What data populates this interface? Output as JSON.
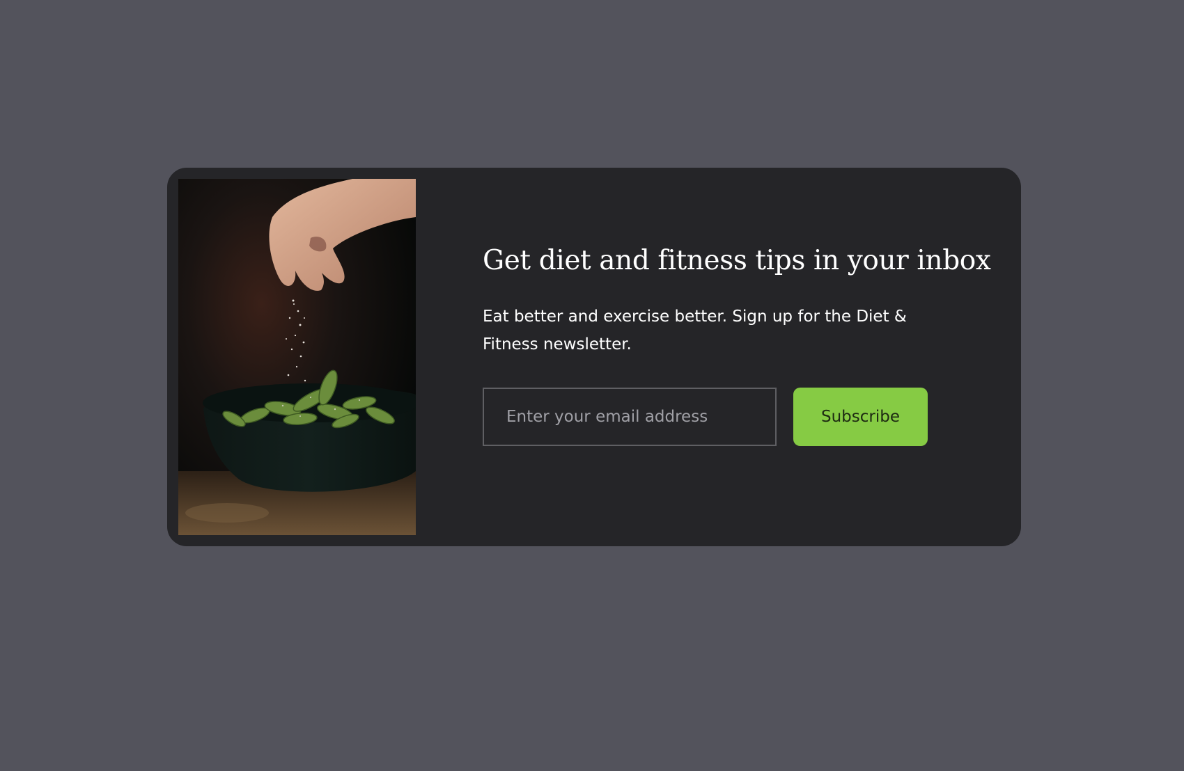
{
  "newsletter": {
    "image_alt": "Hand sprinkling salt over a bowl of edamame",
    "title": "Get diet and fitness tips in your inbox",
    "description": "Eat better and exercise better. Sign up for the Diet & Fitness newsletter.",
    "email_placeholder": "Enter your email address",
    "email_value": "",
    "subscribe_label": "Subscribe"
  },
  "colors": {
    "page_background": "#53535c",
    "card_background": "#252528",
    "accent_button": "#86cb44",
    "text": "#ffffff"
  }
}
